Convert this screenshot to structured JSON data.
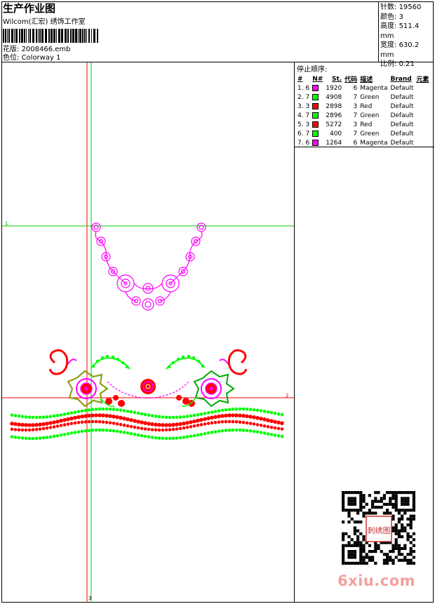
{
  "header": {
    "title": "生产作业图",
    "subtitle": "Wilcom(汇宏) 绣饰工作室",
    "design_label": "花版:",
    "design_value": "2008466.emb",
    "colorway_label": "色位:",
    "colorway_value": "Colorway 1"
  },
  "stats": {
    "stitches_label": "针数:",
    "stitches_value": "19560",
    "colors_label": "颜色:",
    "colors_value": "3",
    "height_label": "高度:",
    "height_value": "511.4 mm",
    "width_label": "宽度:",
    "width_value": "630.2 mm",
    "scale_label": "比例:",
    "scale_value": "0.21"
  },
  "stop_sequence": {
    "heading": "停止顺序:",
    "columns": [
      "#",
      "N#",
      "St.",
      "代码",
      "描述",
      "Brand",
      "元素"
    ],
    "rows": [
      {
        "idx": "1.",
        "n": "6",
        "st": "1920",
        "code": "6",
        "desc": "Magenta",
        "brand": "Default",
        "color": "#ff00ff"
      },
      {
        "idx": "2.",
        "n": "7",
        "st": "4908",
        "code": "7",
        "desc": "Green",
        "brand": "Default",
        "color": "#00ff00"
      },
      {
        "idx": "3.",
        "n": "3",
        "st": "2898",
        "code": "3",
        "desc": "Red",
        "brand": "Default",
        "color": "#ff0000"
      },
      {
        "idx": "4.",
        "n": "7",
        "st": "2896",
        "code": "7",
        "desc": "Green",
        "brand": "Default",
        "color": "#00ff00"
      },
      {
        "idx": "5.",
        "n": "3",
        "st": "5272",
        "code": "3",
        "desc": "Red",
        "brand": "Default",
        "color": "#ff0000"
      },
      {
        "idx": "6.",
        "n": "7",
        "st": "400",
        "code": "7",
        "desc": "Green",
        "brand": "Default",
        "color": "#00ff00"
      },
      {
        "idx": "7.",
        "n": "6",
        "st": "1264",
        "code": "6",
        "desc": "Magenta",
        "brand": "Default",
        "color": "#ff00ff"
      }
    ]
  },
  "canvas": {
    "marker_top": "1",
    "marker_right": "2",
    "marker_bottom": "3"
  },
  "qr_stamp": "刺绣图",
  "watermark": "6xiu.com",
  "colors": {
    "magenta": "#ff00ff",
    "green": "#00ff00",
    "red": "#ff0000",
    "axis_red": "#ff0000",
    "axis_green": "#00cc00",
    "watermark": "#f4a0a0"
  }
}
